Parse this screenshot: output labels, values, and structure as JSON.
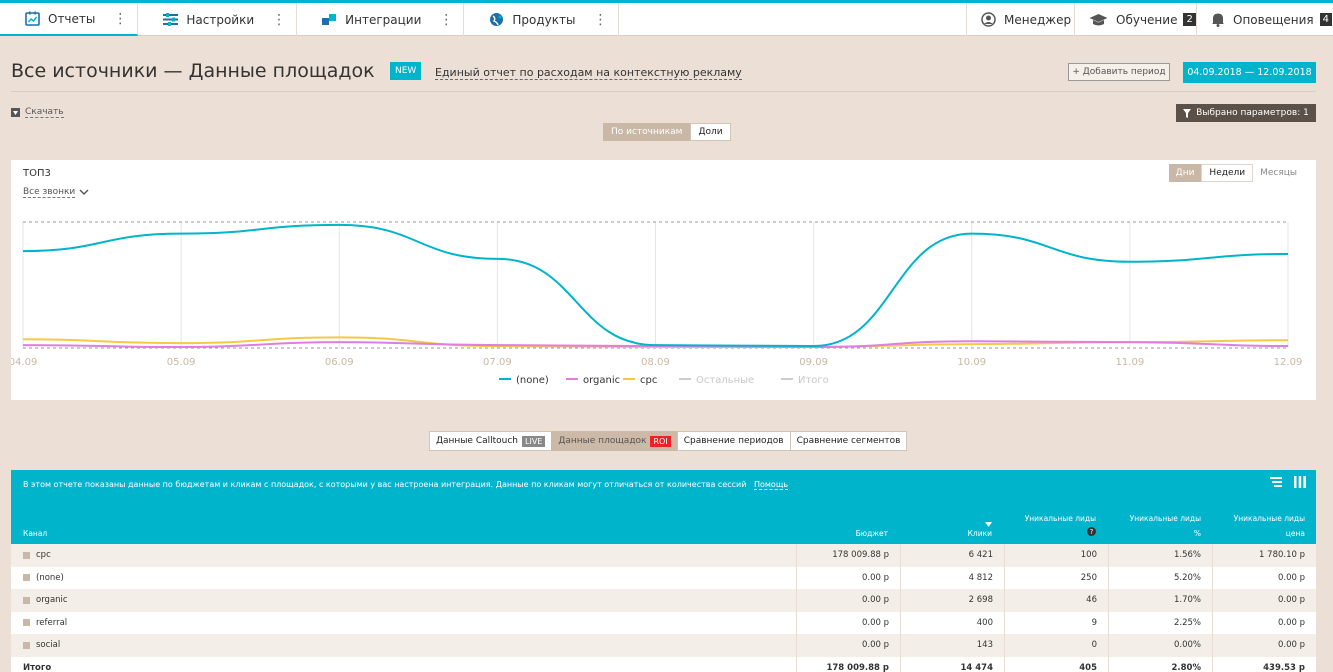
{
  "nav": {
    "items": [
      {
        "label": "Отчеты",
        "icon": "chart-calendar-icon"
      },
      {
        "label": "Настройки",
        "icon": "sliders-icon"
      },
      {
        "label": "Интеграции",
        "icon": "puzzle-icon"
      },
      {
        "label": "Продукты",
        "icon": "globe-icon"
      }
    ],
    "right": [
      {
        "label": "Менеджер",
        "icon": "user-icon"
      },
      {
        "label": "Обучение",
        "icon": "graduation-cap-icon",
        "badge": "2"
      },
      {
        "label": "Оповещения",
        "icon": "bell-icon",
        "badge": "4"
      }
    ]
  },
  "header": {
    "title": "Все источники — Данные площадок",
    "new_badge": "NEW",
    "promo_link": "Единый отчет по расходам на контекстную рекламу",
    "add_period": "+ Добавить период",
    "date_range": "04.09.2018  —  12.09.2018"
  },
  "toolbar": {
    "download": "Скачать",
    "params": "Выбрано параметров: 1",
    "view_toggle": [
      "По источникам",
      "Доли"
    ]
  },
  "chart_card": {
    "title": "ТОП3",
    "calls_select": "Все звонки",
    "period_toggle": [
      "Дни",
      "Недели",
      "Месяцы"
    ]
  },
  "chart_data": {
    "type": "line",
    "x": [
      "04.09",
      "05.09",
      "06.09",
      "07.09",
      "08.09",
      "09.09",
      "10.09",
      "11.09",
      "12.09"
    ],
    "ylim": [
      0,
      130
    ],
    "grid": true,
    "legend_position": "bottom",
    "series": [
      {
        "name": "(none)",
        "color": "#00b4cc",
        "values": [
          100,
          118,
          127,
          92,
          3,
          2,
          118,
          89,
          97
        ]
      },
      {
        "name": "organic",
        "color": "#e07de0",
        "values": [
          3,
          1,
          6,
          3,
          2,
          1,
          7,
          6,
          2
        ]
      },
      {
        "name": "cpc",
        "color": "#f6c945",
        "values": [
          9,
          5,
          11,
          2,
          1,
          1,
          4,
          6,
          8
        ]
      },
      {
        "name": "Остальные",
        "color": "#cccccc",
        "values": []
      },
      {
        "name": "Итого",
        "color": "#cccccc",
        "values": []
      }
    ]
  },
  "report_tabs": [
    {
      "label": "Данные Calltouch",
      "tag": "LIVE"
    },
    {
      "label": "Данные площадок",
      "tag": "ROI"
    },
    {
      "label": "Сравнение периодов",
      "tag": ""
    },
    {
      "label": "Сравнение сегментов",
      "tag": ""
    }
  ],
  "table": {
    "info": "В этом отчете показаны данные по бюджетам и кликам с площадок, с которыми у вас настроена интеграция. Данные по кликам могут отличаться от количества сессий",
    "help_link": "Помощь",
    "headers": {
      "channel": "Канал",
      "budget": "Бюджет",
      "clicks": "Клики",
      "leads": "Уникальные лиды",
      "leads_pct_top": "Уникальные лиды",
      "leads_pct": "%",
      "leads_price_top": "Уникальные лиды",
      "leads_price": "цена"
    },
    "rows": [
      [
        "cpc",
        "178 009.88 р",
        "6 421",
        "100",
        "1.56%",
        "1 780.10 р"
      ],
      [
        "(none)",
        "0.00 р",
        "4 812",
        "250",
        "5.20%",
        "0.00 р"
      ],
      [
        "organic",
        "0.00 р",
        "2 698",
        "46",
        "1.70%",
        "0.00 р"
      ],
      [
        "referral",
        "0.00 р",
        "400",
        "9",
        "2.25%",
        "0.00 р"
      ],
      [
        "social",
        "0.00 р",
        "143",
        "0",
        "0.00%",
        "0.00 р"
      ]
    ],
    "total": [
      "Итого",
      "178 009.88 р",
      "14 474",
      "405",
      "2.80%",
      "439.53 р"
    ]
  }
}
